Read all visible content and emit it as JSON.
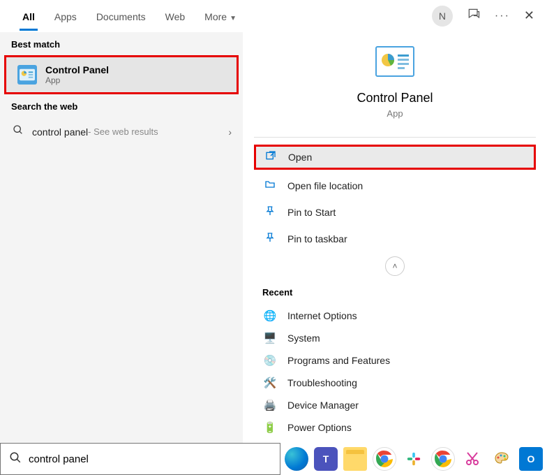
{
  "tabs": [
    "All",
    "Apps",
    "Documents",
    "Web",
    "More"
  ],
  "user_initial": "N",
  "left": {
    "best_match_label": "Best match",
    "best_match": {
      "title": "Control Panel",
      "subtitle": "App"
    },
    "search_web_label": "Search the web",
    "web_query": "control panel",
    "web_hint": " - See web results"
  },
  "right": {
    "hero_title": "Control Panel",
    "hero_sub": "App",
    "actions": [
      "Open",
      "Open file location",
      "Pin to Start",
      "Pin to taskbar"
    ],
    "recent_label": "Recent",
    "recent": [
      "Internet Options",
      "System",
      "Programs and Features",
      "Troubleshooting",
      "Device Manager",
      "Power Options"
    ]
  },
  "search_value": "control panel",
  "taskbar_apps": [
    "Edge",
    "Teams",
    "File Explorer",
    "Chrome",
    "Slack",
    "Chrome",
    "Snipping Tool",
    "Paint",
    "Outlook"
  ]
}
